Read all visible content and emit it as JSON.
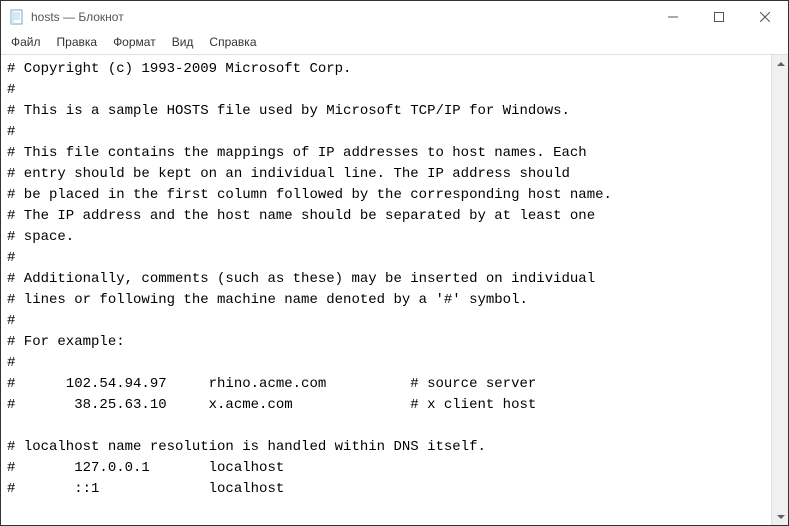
{
  "titlebar": {
    "title": "hosts — Блокнот"
  },
  "menubar": {
    "items": [
      {
        "label": "Файл"
      },
      {
        "label": "Правка"
      },
      {
        "label": "Формат"
      },
      {
        "label": "Вид"
      },
      {
        "label": "Справка"
      }
    ]
  },
  "editor": {
    "content": "# Copyright (c) 1993-2009 Microsoft Corp.\n#\n# This is a sample HOSTS file used by Microsoft TCP/IP for Windows.\n#\n# This file contains the mappings of IP addresses to host names. Each\n# entry should be kept on an individual line. The IP address should\n# be placed in the first column followed by the corresponding host name.\n# The IP address and the host name should be separated by at least one\n# space.\n#\n# Additionally, comments (such as these) may be inserted on individual\n# lines or following the machine name denoted by a '#' symbol.\n#\n# For example:\n#\n#      102.54.94.97     rhino.acme.com          # source server\n#       38.25.63.10     x.acme.com              # x client host\n\n# localhost name resolution is handled within DNS itself.\n#       127.0.0.1       localhost\n#       ::1             localhost"
  }
}
